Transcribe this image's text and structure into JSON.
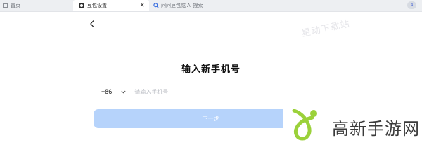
{
  "tabs": {
    "home": "首页",
    "active": "豆包设置",
    "search": "问问豆包或 AI 搜索",
    "avatar": "4"
  },
  "watermark_top": "星动下载站",
  "login": {
    "title": "输入新手机号",
    "country_code": "+86",
    "phone_placeholder": "请输入手机号",
    "next_label": "下一步"
  },
  "watermark_bottom": "高新手游网",
  "colors": {
    "button": "#b6d3fb",
    "logo_green": "#9bd13a",
    "logo_dark": "#3a3a3a"
  }
}
